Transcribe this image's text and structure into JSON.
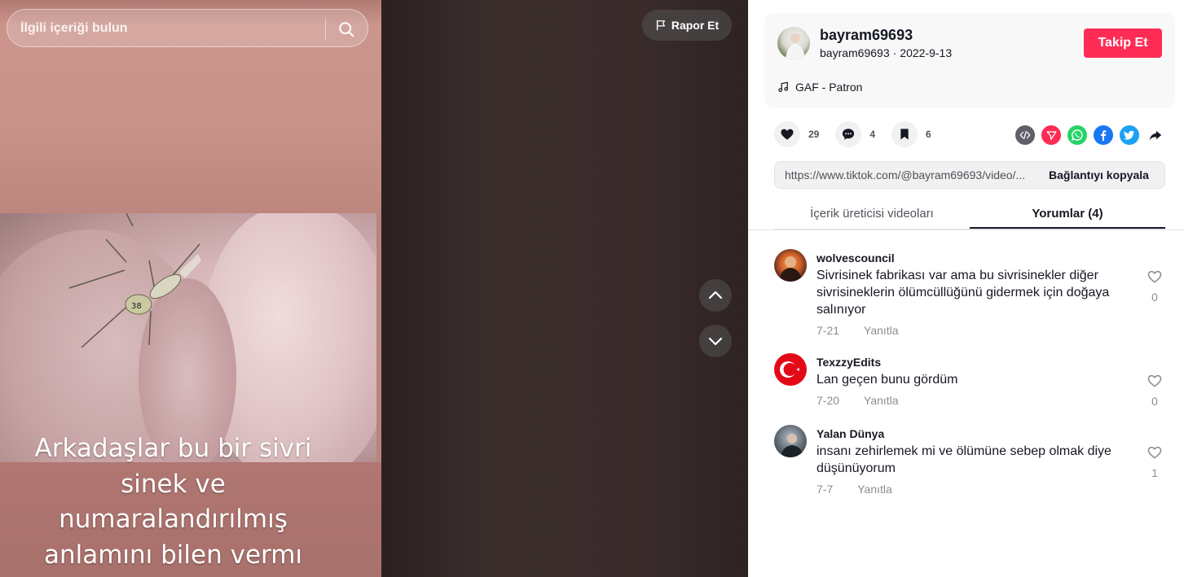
{
  "search": {
    "placeholder": "İlgili içeriği bulun"
  },
  "video": {
    "report_label": "Rapor Et",
    "caption_lines": [
      "Arkadaşlar bu bir sivri",
      "sinek ve",
      "numaralandırılmış",
      "anlamını bilen vermı"
    ]
  },
  "author": {
    "username": "bayram69693",
    "handle": "bayram69693",
    "date": "2022-9-13",
    "follow_label": "Takip Et",
    "music": "GAF - Patron"
  },
  "stats": {
    "likes": "29",
    "comments": "4",
    "saves": "6"
  },
  "share_icons": [
    "embed-icon",
    "send-icon",
    "whatsapp-icon",
    "facebook-icon",
    "twitter-icon",
    "share-arrow-icon"
  ],
  "link": {
    "url": "https://www.tiktok.com/@bayram69693/video/...",
    "copy_label": "Bağlantıyı kopyala"
  },
  "tabs": [
    {
      "label": "İçerik üreticisi videoları"
    },
    {
      "label": "Yorumlar (4)"
    }
  ],
  "comments": [
    {
      "name": "wolvescouncil",
      "text": "Sivrisinek fabrikası var ama bu sivrisinekler diğer sivrisineklerin ölümcüllüğünü gidermek için doğaya salınıyor",
      "date": "7-21",
      "reply": "Yanıtla",
      "likes": "0"
    },
    {
      "name": "TexzzyEdits",
      "text": "Lan geçen bunu gördüm",
      "date": "7-20",
      "reply": "Yanıtla",
      "likes": "0"
    },
    {
      "name": "Yalan Dünya",
      "text": "insanı zehirlemek mi ve ölümüne sebep olmak diye düşünüyorum",
      "date": "7-7",
      "reply": "Yanıtla",
      "likes": "1"
    }
  ],
  "colors": {
    "accent": "#fe2c55",
    "whatsapp": "#25d366",
    "facebook": "#1877f2",
    "twitter": "#1da1f2"
  }
}
